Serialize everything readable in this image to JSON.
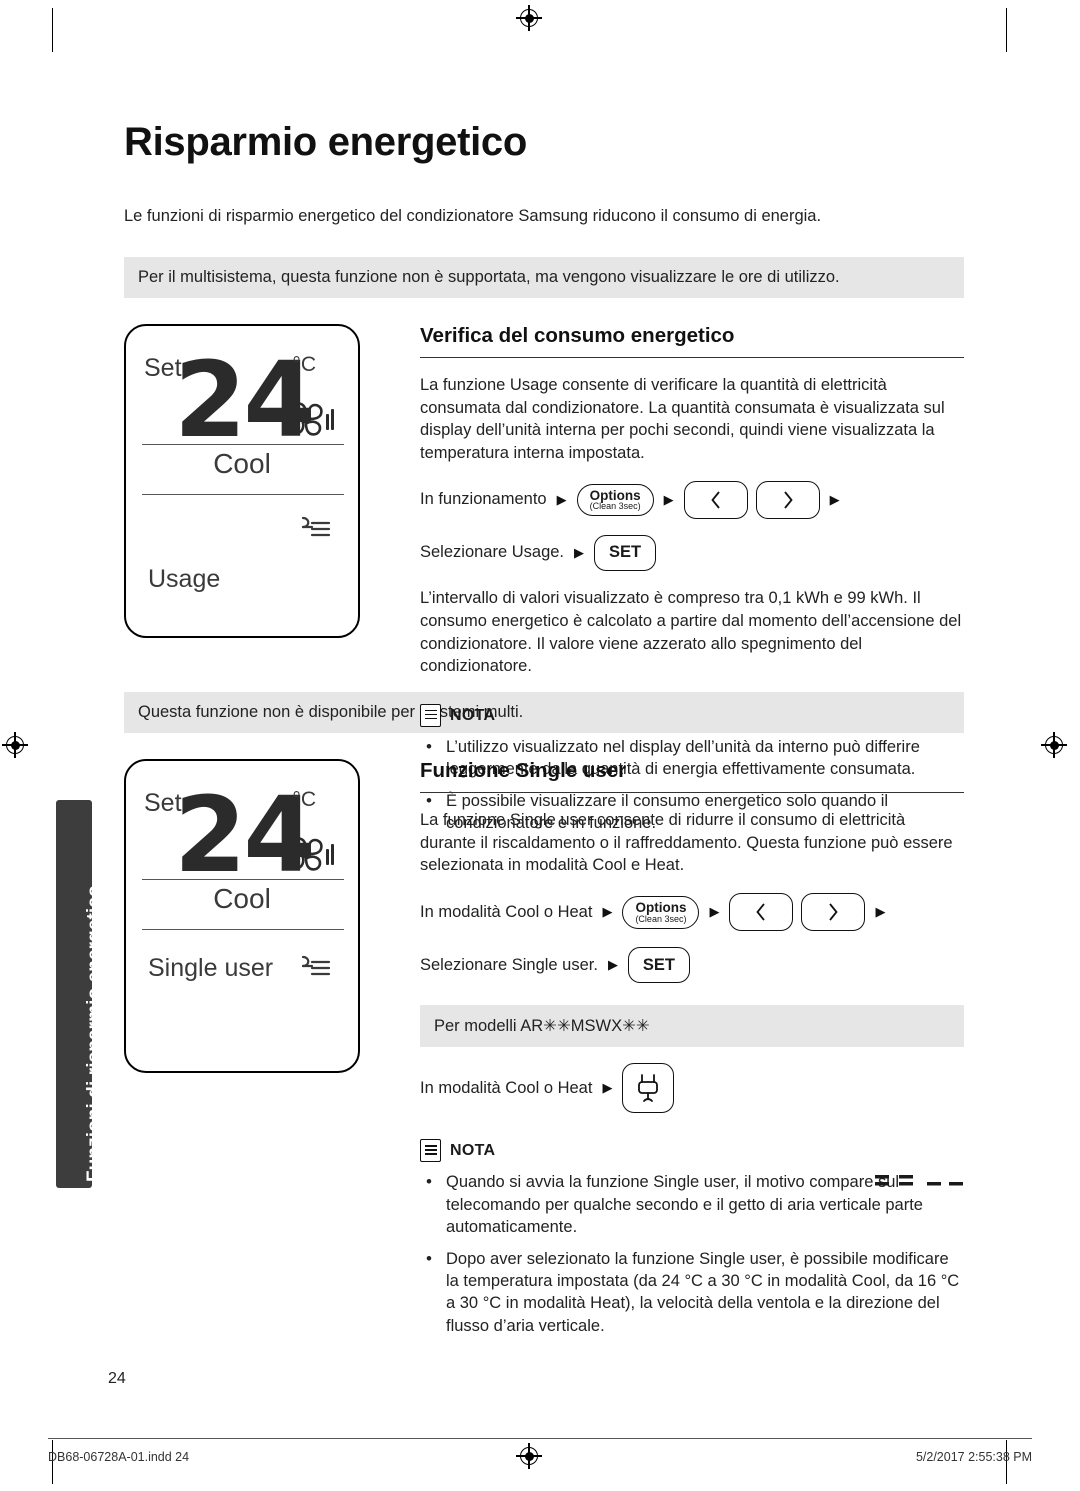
{
  "sidetab": {
    "label": "Funzioni di risparmio energetico"
  },
  "title": "Risparmio energetico",
  "intro": "Le funzioni di risparmio energetico del condizionatore Samsung riducono il consumo di energia.",
  "section1": {
    "graybar": "Per il multisistema, questa funzione non è supportata, ma vengono visualizzare le ore di utilizzo.",
    "display": {
      "set": "Set",
      "temp": "24",
      "unit": "°C",
      "mode": "Cool",
      "label": "Usage"
    },
    "heading": "Verifica del consumo energetico",
    "paragraph": "La funzione Usage consente di verificare la quantità di elettricità consumata dal condizionatore. La quantità consumata è visualizzata sul display dell’unità interna per pochi secondi, quindi viene visualizzata la temperatura interna impostata.",
    "step1_text": "In funzionamento",
    "step2_text": "Selezionare Usage.",
    "options_label": "Options",
    "options_sub": "(Clean 3sec)",
    "left_icon": "chevron-left",
    "right_icon": "chevron-right",
    "set_label": "SET",
    "paragraph2": "L’intervallo di valori visualizzato è compreso tra 0,1 kWh e 99 kWh. Il consumo energetico è calcolato a partire dal momento dell’accensione del condizionatore. Il valore viene azzerato allo spegnimento del condizionatore.",
    "note_label": "NOTA",
    "notes": [
      "L’utilizzo visualizzato nel display dell’unità da interno può differire leggermente dalla quantità di energia effettivamente consumata.",
      "È possibile visualizzare il consumo energetico solo quando il condizionatore è in funzione."
    ]
  },
  "section2": {
    "graybar": "Questa funzione non è disponibile per i sistemi multi.",
    "display": {
      "set": "Set",
      "temp": "24",
      "unit": "°C",
      "mode": "Cool",
      "label": "Single user"
    },
    "heading": "Funzione Single user",
    "paragraph": "La funzione Single user consente di ridurre il consumo di elettricità durante il riscaldamento o il raffreddamento. Questa funzione può essere selezionata in modalità Cool e Heat.",
    "step1_text": "In modalità Cool o Heat",
    "step2_text": "Selezionare Single user.",
    "options_label": "Options",
    "options_sub": "(Clean 3sec)",
    "set_label": "SET",
    "models_bar": "Per modelli AR✳✳MSWX✳✳",
    "step3_text": "In modalità Cool o Heat",
    "note_label": "NOTA",
    "notes": [
      "Quando si avvia la funzione Single user, il motivo         compare sul telecomando per qualche secondo e il getto di aria verticale parte automaticamente.",
      "Dopo aver selezionato la funzione Single user, è possibile modificare la temperatura impostata (da 24 °C a 30 °C in modalità Cool, da 16 °C a 30 °C in modalità Heat), la velocità della ventola e la direzione del flusso d’aria verticale."
    ]
  },
  "footer": {
    "page_number": "24",
    "left": "DB68-06728A-01.indd   24",
    "right": "5/2/2017   2:55:38 PM"
  }
}
